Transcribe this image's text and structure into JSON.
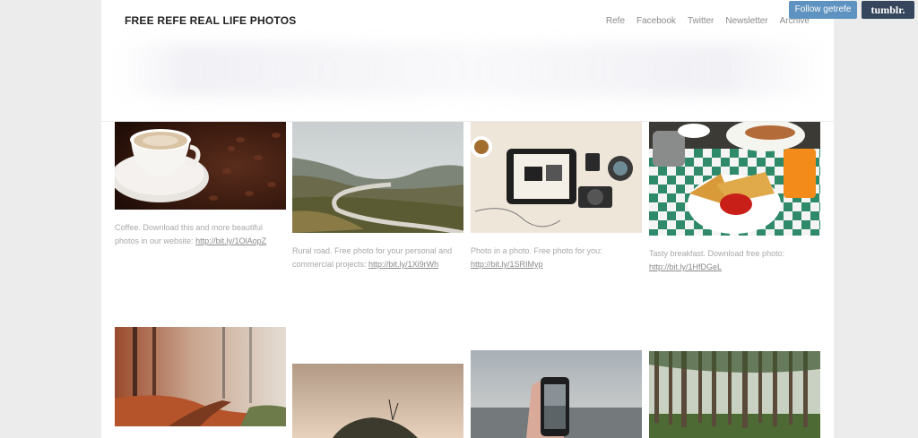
{
  "blog": {
    "title": "FREE REFE REAL LIFE PHOTOS"
  },
  "nav": {
    "items": [
      "Refe",
      "Facebook",
      "Twitter",
      "Newsletter",
      "Archive"
    ]
  },
  "tumblr_controls": {
    "follow_label": "Follow getrefe",
    "logo_label": "tumblr."
  },
  "posts": [
    {
      "caption": "Coffee. Download this and more beautiful photos in our website:",
      "link": "http://bit.ly/1OlAopZ"
    },
    {
      "caption": "Rural road. Free photo for your personal and commercial projects:",
      "link": "http://bit.ly/1Xi9rWh"
    },
    {
      "caption": "Photo in a photo. Free photo for you:",
      "link": "http://bit.ly/1SRIMyp"
    },
    {
      "caption": "Tasty breakfast. Download free photo:",
      "link": "http://bit.ly/1HfDGeL"
    }
  ]
}
